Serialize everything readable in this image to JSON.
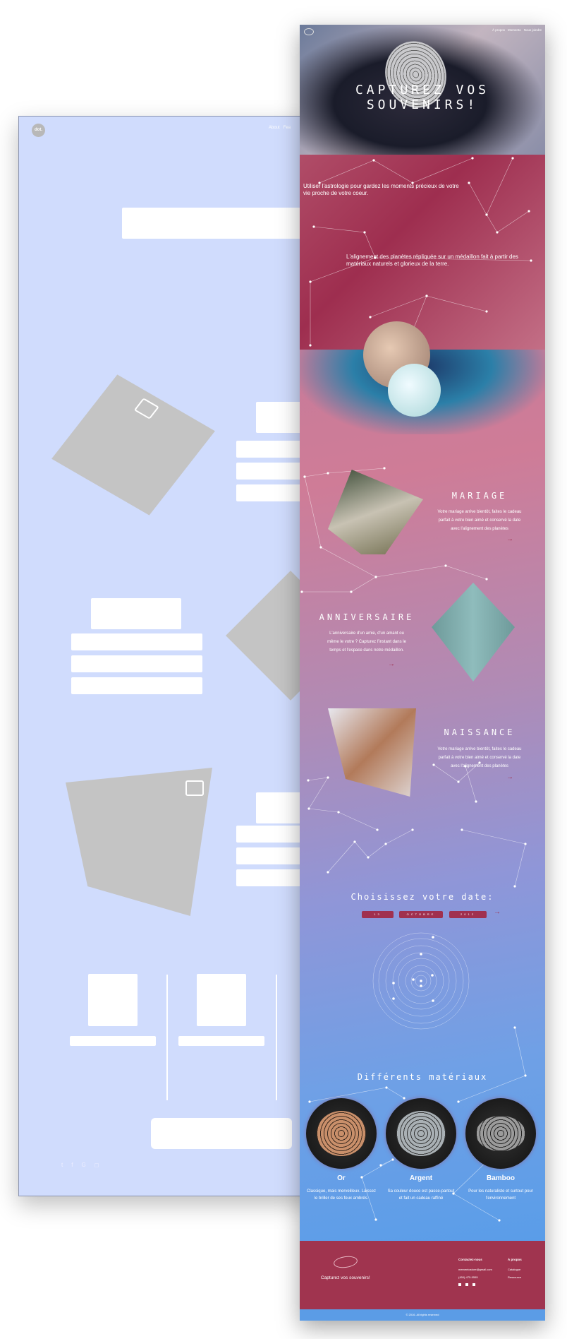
{
  "wireframe": {
    "logo": "dot.",
    "nav": [
      "About",
      "Fea"
    ],
    "social_icons": [
      "twitter-icon",
      "facebook-icon",
      "google-icon",
      "instagram-icon"
    ]
  },
  "nav": {
    "items": [
      "À propos",
      "Momento",
      "Nous joindre"
    ]
  },
  "hero": {
    "title": "CAPTUREZ VOS SOUVENIRS!"
  },
  "intro": {
    "text1": "Utiliser l'astrologie pour gardez les moments précieux de votre vie proche de votre coeur.",
    "text2": "L'alignement des planètes répliquée sur un médaillon fait à partir des matériaux naturels et glorieux de la terre."
  },
  "occasions": [
    {
      "title": "MARIAGE",
      "text": "Votre mariage arrive bientôt, faites le cadeau parfait à votre bien aimé et conservé la date avec l'alignement des planètes",
      "arrow": "→"
    },
    {
      "title": "ANNIVERSAIRE",
      "text": "L'anniversaire d'un amie, d'un amant ou même le votre ? Capturez l'instant dans le temps et l'espace dans notre médaillon.",
      "arrow": "→"
    },
    {
      "title": "NAISSANCE",
      "text": "Votre mariage arrive bientôt, faites le cadeau parfait à votre bien aimé et conservé la date avec l'alignement des planètes",
      "arrow": "→"
    }
  ],
  "date": {
    "title": "Choisissez votre date:",
    "day": "13",
    "month": "OCTOBRE",
    "year": "2012",
    "arrow": "→"
  },
  "materials": {
    "title": "Différents matériaux",
    "items": [
      {
        "name": "Or",
        "text": "Classique, mais merveilleux. Laissez le briller de ses feux ambrés.",
        "color": "#c98f6a"
      },
      {
        "name": "Argent",
        "text": "Sa couleur douce est passe-partout et fait un cadeau raffiné",
        "color": "#a9b0b4"
      },
      {
        "name": "Bamboo",
        "text": "Pour les naturaliste et surtout pour l'environnement",
        "color": "#9b9b9b"
      }
    ]
  },
  "footer": {
    "tagline": "Capturez vos souvenirs!",
    "contact_title": "Contactez-nous",
    "email": "mementostore@gmail.com",
    "phone": "(450)-475-5555",
    "about_title": "À propos",
    "links": [
      "Catalogue",
      "Ressource"
    ],
    "copyright": "© 2016. All rights reserved"
  },
  "colors": {
    "accent": "#a0304f",
    "wire_bg": "#d0dcfd",
    "footer_bar": "#5b9ce6"
  }
}
